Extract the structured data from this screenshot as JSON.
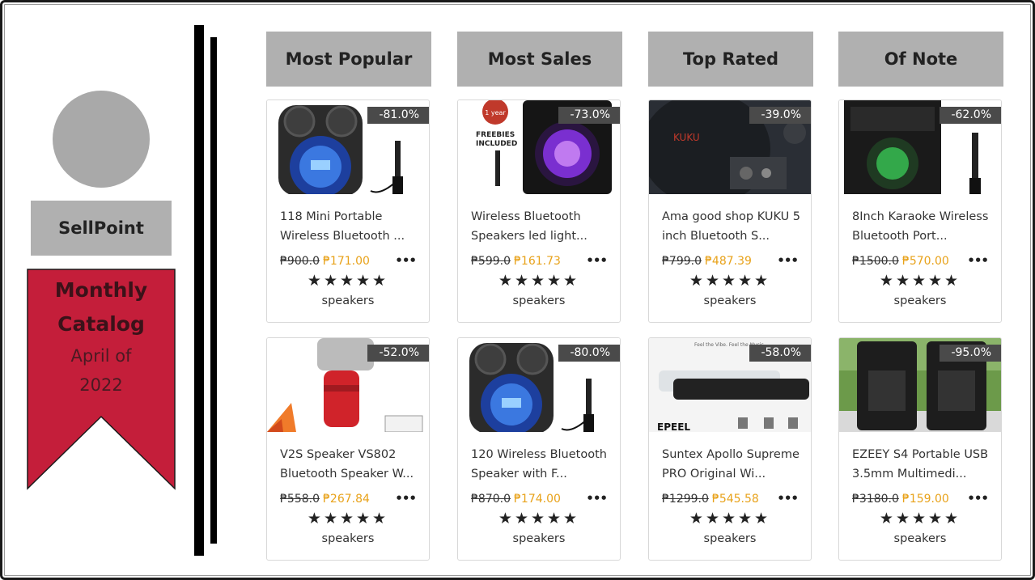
{
  "sidebar": {
    "brand": "SellPoint",
    "banner_title": "Monthly Catalog",
    "banner_subtitle": "April of 2022",
    "banner_color": "#c41e3a"
  },
  "columns": [
    "Most Popular",
    "Most Sales",
    "Top Rated",
    "Of Note"
  ],
  "products": [
    {
      "discount": "-81.0%",
      "title": "118 Mini Portable Wireless Bluetooth ...",
      "old_price": "₱900.0",
      "new_price": "₱171.00",
      "category": "speakers",
      "stars": "★★★★★",
      "image": "speaker-blue-icon"
    },
    {
      "discount": "-73.0%",
      "title": "Wireless Bluetooth Speakers led light...",
      "old_price": "₱599.0",
      "new_price": "₱161.73",
      "category": "speakers",
      "stars": "★★★★★",
      "image": "speaker-purple-icon"
    },
    {
      "discount": "-39.0%",
      "title": "Ama good shop KUKU 5 inch Bluetooth S...",
      "old_price": "₱799.0",
      "new_price": "₱487.39",
      "category": "speakers",
      "stars": "★★★★★",
      "image": "subwoofer-icon"
    },
    {
      "discount": "-62.0%",
      "title": "8Inch Karaoke Wireless Bluetooth Port...",
      "old_price": "₱1500.0",
      "new_price": "₱570.00",
      "category": "speakers",
      "stars": "★★★★★",
      "image": "karaoke-speaker-icon"
    },
    {
      "discount": "-52.0%",
      "title": "V2S Speaker VS802 Bluetooth Speaker W...",
      "old_price": "₱558.0",
      "new_price": "₱267.84",
      "category": "speakers",
      "stars": "★★★★★",
      "image": "red-speaker-icon"
    },
    {
      "discount": "-80.0%",
      "title": "120 Wireless Bluetooth Speaker with F...",
      "old_price": "₱870.0",
      "new_price": "₱174.00",
      "category": "speakers",
      "stars": "★★★★★",
      "image": "speaker-blue-icon"
    },
    {
      "discount": "-58.0%",
      "title": "Suntex Apollo Supreme PRO Original Wi...",
      "old_price": "₱1299.0",
      "new_price": "₱545.58",
      "category": "speakers",
      "stars": "★★★★★",
      "image": "soundbar-icon"
    },
    {
      "discount": "-95.0%",
      "title": "EZEEY S4 Portable USB 3.5mm Multimedi...",
      "old_price": "₱3180.0",
      "new_price": "₱159.00",
      "category": "speakers",
      "stars": "★★★★★",
      "image": "desktop-speakers-icon"
    }
  ],
  "more_label": "•••"
}
